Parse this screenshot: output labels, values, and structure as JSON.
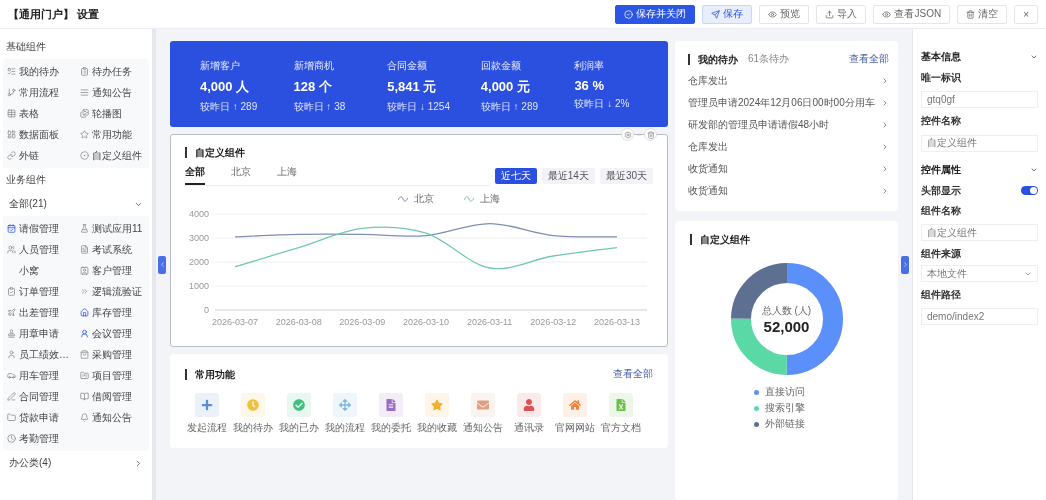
{
  "header": {
    "title": "【通用门户】 设置",
    "buttons": [
      {
        "label": "保存并关闭",
        "kind": "primary"
      },
      {
        "label": "保存",
        "kind": "light"
      },
      {
        "label": "预览",
        "kind": "plain"
      },
      {
        "label": "导入",
        "kind": "plain"
      },
      {
        "label": "查看JSON",
        "kind": "plain"
      },
      {
        "label": "清空",
        "kind": "plain"
      },
      {
        "label": "×",
        "kind": "close"
      }
    ]
  },
  "sidebar": {
    "basic": {
      "title": "基础组件",
      "items": [
        "我的待办",
        "待办任务",
        "常用流程",
        "通知公告",
        "表格",
        "轮播图",
        "数据面板",
        "常用功能",
        "外链",
        "自定义组件"
      ]
    },
    "business": {
      "title": "业务组件",
      "groups": [
        {
          "label": "全部(21)",
          "expanded": true,
          "items": [
            "请假管理",
            "测试应用11",
            "人员管理",
            "考试系统",
            "小窝",
            "客户管理",
            "订单管理",
            "逻辑流验证",
            "出差管理",
            "库存管理",
            "用章申请",
            "会议管理",
            "员工绩效…",
            "采购管理",
            "用车管理",
            "项目管理",
            "合同管理",
            "借阅管理",
            "贷款申请",
            "通知公告",
            "考勤管理"
          ]
        },
        {
          "label": "办公类(4)",
          "expanded": false
        }
      ]
    }
  },
  "stats": [
    {
      "label": "新增客户",
      "value": "4,000 人",
      "compare": "较昨日 ↑ 289"
    },
    {
      "label": "新增商机",
      "value": "128 个",
      "compare": "较昨日 ↑ 38"
    },
    {
      "label": "合同金额",
      "value": "5,841 元",
      "compare": "较昨日 ↓ 1254"
    },
    {
      "label": "回款金额",
      "value": "4,000 元",
      "compare": "较昨日 ↑ 289"
    },
    {
      "label": "利润率",
      "value": "36 %",
      "compare": "较昨日 ↓ 2%"
    }
  ],
  "trend_card": {
    "title": "自定义组件",
    "tabs": [
      {
        "label": "全部",
        "selected": true
      },
      {
        "label": "北京",
        "selected": false
      },
      {
        "label": "上海",
        "selected": false
      }
    ],
    "ranges": [
      {
        "label": "近七天",
        "selected": true
      },
      {
        "label": "最近14天",
        "selected": false
      },
      {
        "label": "最近30天",
        "selected": false
      }
    ],
    "chart_data": {
      "type": "line",
      "categories": [
        "2026-03-07",
        "2026-03-08",
        "2026-03-09",
        "2026-03-10",
        "2026-03-11",
        "2026-03-12",
        "2026-03-13"
      ],
      "ylim": [
        0,
        4000
      ],
      "grid": true,
      "yticks": [
        0,
        1000,
        2000,
        3000,
        4000
      ],
      "series": [
        {
          "name": "北京",
          "color": "#7f8fb3",
          "values": [
            3050,
            3150,
            3150,
            3100,
            3600,
            3100,
            3050
          ]
        },
        {
          "name": "上海",
          "color": "#72c7b4",
          "values": [
            1800,
            2600,
            3400,
            3200,
            1750,
            2250,
            2600
          ]
        }
      ]
    }
  },
  "functions": {
    "title": "常用功能",
    "link": "查看全部",
    "items": [
      {
        "label": "发起流程",
        "color": "#5b8fc9"
      },
      {
        "label": "我的待办",
        "color": "#f0c040"
      },
      {
        "label": "我的已办",
        "color": "#3fbf7f"
      },
      {
        "label": "我的流程",
        "color": "#7fb8e0"
      },
      {
        "label": "我的委托",
        "color": "#9a6bc9"
      },
      {
        "label": "我的收藏",
        "color": "#f0b030"
      },
      {
        "label": "通知公告",
        "color": "#e0a080"
      },
      {
        "label": "通讯录",
        "color": "#e05050"
      },
      {
        "label": "官网网站",
        "color": "#f08040"
      },
      {
        "label": "官方文档",
        "color": "#6cbf4a"
      }
    ]
  },
  "todo": {
    "title": "我的待办",
    "count": "61条待办",
    "link": "查看全部",
    "items": [
      "仓库发出",
      "管理员申请2024年12月06日00时00分用车",
      "研发部的管理员申请请假48小时",
      "仓库发出",
      "收货通知",
      "收货通知"
    ]
  },
  "donut_card": {
    "title": "自定义组件",
    "center_label": "总人数 (人)",
    "center_value": "52,000",
    "legend": [
      {
        "label": "直接访问",
        "color": "#5b8ff9"
      },
      {
        "label": "搜索引擎",
        "color": "#5ad8a6"
      },
      {
        "label": "外部链接",
        "color": "#5d7092"
      }
    ]
  },
  "props": {
    "sections": [
      {
        "title": "基本信息",
        "expanded": true,
        "fields": [
          {
            "kind": "input",
            "label": "唯一标识",
            "value": "gtq0gf"
          },
          {
            "kind": "input",
            "label": "控件名称",
            "value": "自定义组件"
          }
        ]
      },
      {
        "title": "控件属性",
        "expanded": true,
        "fields": [
          {
            "kind": "switch",
            "label": "头部显示",
            "on": true
          },
          {
            "kind": "input",
            "label": "组件名称",
            "value": "自定义组件"
          },
          {
            "kind": "select",
            "label": "组件来源",
            "value": "本地文件"
          },
          {
            "kind": "input",
            "label": "组件路径",
            "value": "demo/index2"
          }
        ]
      }
    ]
  }
}
